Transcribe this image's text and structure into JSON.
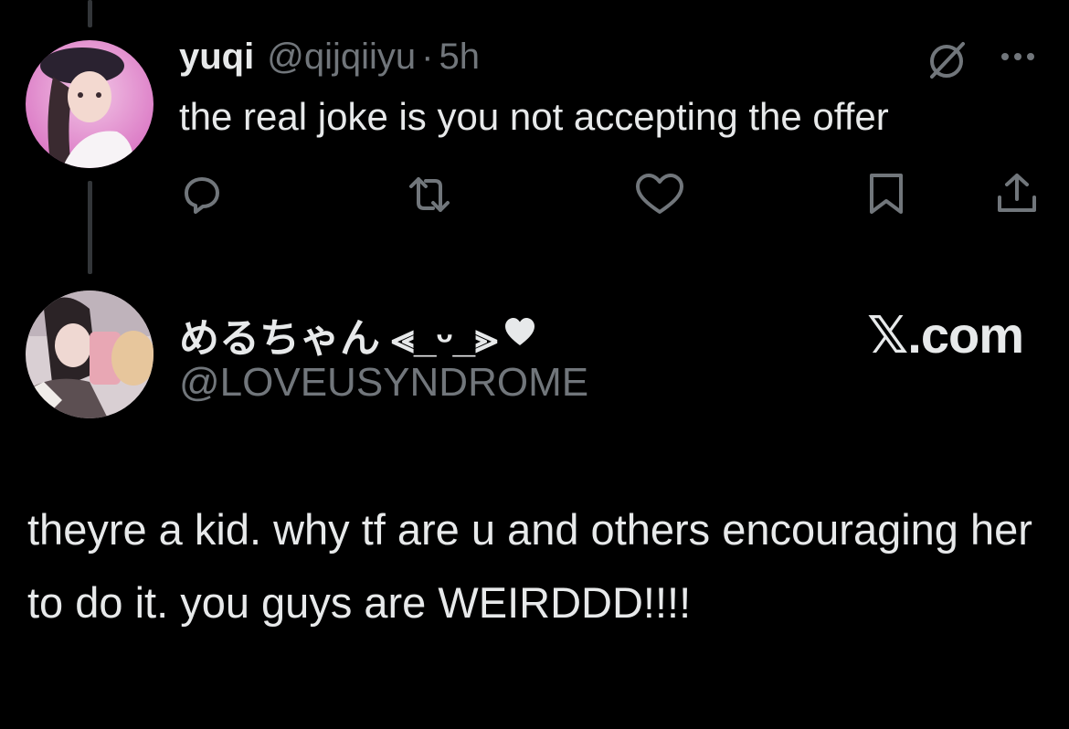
{
  "reply": {
    "name": "yuqi",
    "handle": "@qijqiiyu",
    "separator": "·",
    "time": "5h",
    "text": "the real joke is you not accepting the offer",
    "avatar_icon": "user-avatar-photo"
  },
  "actions": [
    {
      "icon": "reply-icon"
    },
    {
      "icon": "retweet-icon"
    },
    {
      "icon": "like-icon"
    },
    {
      "icon": "bookmark-icon"
    },
    {
      "icon": "share-icon"
    }
  ],
  "quoted": {
    "name": "めるちゃん ⪡_ᵕ_⪢",
    "name_suffix_icon": "heart-icon",
    "handle": "@LOVEUSYNDROME",
    "site_label": "𝕏.com",
    "body": "theyre a kid. why tf are u and others encouraging her to do it. you guys are WEIRDDD!!!!"
  },
  "colors": {
    "background": "#000000",
    "primary_text": "#e7e9ea",
    "secondary_text": "#71767b",
    "thread_line": "#333639"
  }
}
